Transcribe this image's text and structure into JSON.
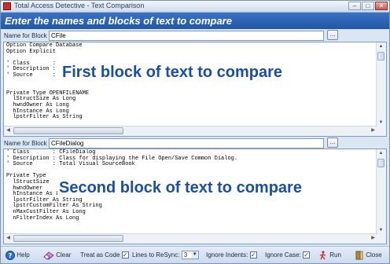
{
  "window": {
    "title": "Total Access Detective - Text Comparison",
    "buttons": [
      "–",
      "□",
      "✕"
    ]
  },
  "header": {
    "text": "Enter the names and blocks of text to compare"
  },
  "block1": {
    "label": "Name for Block 1:",
    "name_value": "CFile",
    "browse_label": "...",
    "overlay": "First block of text to compare",
    "lines": [
      "Option Compare Database",
      "Option Explicit",
      "",
      "' Class       :",
      "' Description :",
      "' Source      :",
      "",
      "",
      "Private Type OPENFILENAME",
      "  lStructSize As Long",
      "  hwndOwner As Long",
      "  hInstance As Long",
      "  lpstrFilter As String"
    ]
  },
  "block2": {
    "label": "Name for Block 2:",
    "name_value": "CFileDialog",
    "browse_label": "...",
    "overlay": "Second block of text to compare",
    "lines": [
      "' Class       : CFileDialog",
      "' Description : Class for displaying the File Open/Save Common Dialog.",
      "' Source      : Total Visual SourceBook",
      "",
      "Private Type",
      "  lStructSize",
      "  hwndOwner",
      "  hInstance As Long",
      "  lpstrFilter As String",
      "  lpstrCustomFilter As String",
      "  nMaxCustFilter As Long",
      "  nFilterIndex As Long"
    ]
  },
  "toolbar": {
    "help_label": "Help",
    "clear_label": "Clear",
    "treat_as_code_label": "Treat as Code",
    "treat_as_code_checked": true,
    "lines_to_resync_label": "Lines to ReSync:",
    "lines_to_resync_value": "3",
    "ignore_indents_label": "Ignore Indents:",
    "ignore_indents_checked": true,
    "ignore_case_label": "Ignore Case:",
    "ignore_case_checked": true,
    "run_label": "Run",
    "close_label": "Close"
  },
  "colors": {
    "header_band": "#2256a6",
    "overlay_text": "#1b4fa0",
    "run_icon": "#c8302c"
  },
  "icons": [
    "app-icon",
    "help-icon",
    "eraser-icon",
    "run-icon",
    "close-door-icon"
  ]
}
